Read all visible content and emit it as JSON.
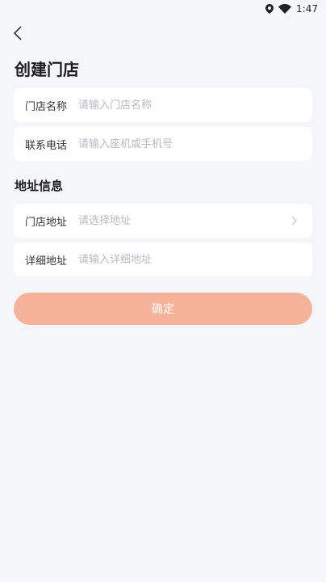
{
  "status": {
    "time": "1:47"
  },
  "page": {
    "title": "创建门店"
  },
  "store": {
    "name_label": "门店名称",
    "name_placeholder": "请输入门店名称",
    "phone_label": "联系电话",
    "phone_placeholder": "请输入座机或手机号"
  },
  "address": {
    "section_title": "地址信息",
    "store_label": "门店地址",
    "store_placeholder": "请选择地址",
    "detail_label": "详细地址",
    "detail_placeholder": "请输入详细地址"
  },
  "actions": {
    "confirm_label": "确定"
  },
  "colors": {
    "accent": "#f7b39a",
    "background": "#f5f6f9"
  }
}
